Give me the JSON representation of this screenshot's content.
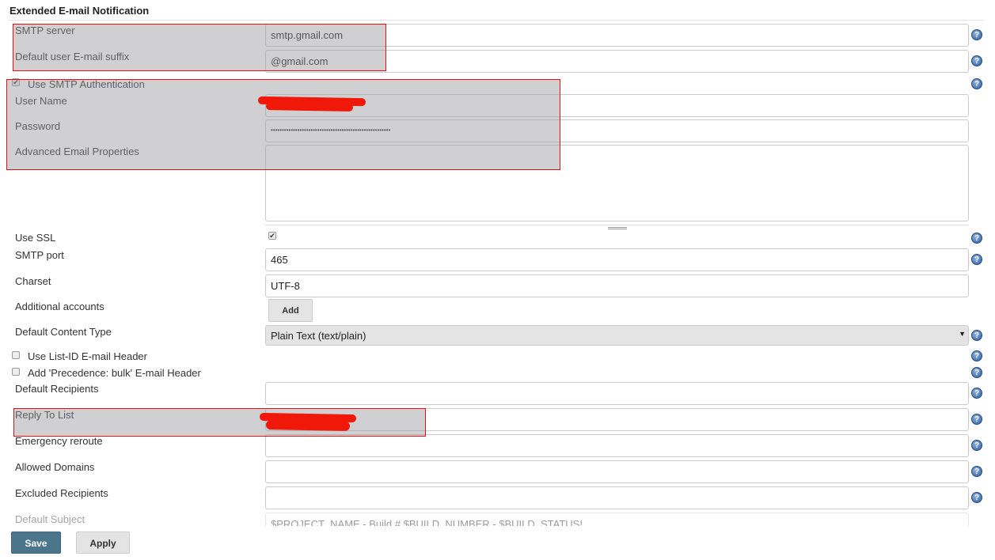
{
  "section_title": "Extended E-mail Notification",
  "fields": {
    "smtp_server": {
      "label": "SMTP server",
      "value": "smtp.gmail.com"
    },
    "email_suffix": {
      "label": "Default user E-mail suffix",
      "value": "@gmail.com"
    },
    "use_smtp_auth": {
      "label": "Use SMTP Authentication",
      "checked": true
    },
    "user_name": {
      "label": "User Name",
      "value": ""
    },
    "password": {
      "label": "Password",
      "value": "••••••••••••••••••••••••••••••••••••••••••••••••••••••"
    },
    "advanced_props": {
      "label": "Advanced Email Properties",
      "value": ""
    },
    "use_ssl": {
      "label": "Use SSL",
      "checked": true
    },
    "smtp_port": {
      "label": "SMTP port",
      "value": "465"
    },
    "charset": {
      "label": "Charset",
      "value": "UTF-8"
    },
    "additional_accounts": {
      "label": "Additional accounts",
      "button": "Add"
    },
    "content_type": {
      "label": "Default Content Type",
      "value": "Plain Text (text/plain)"
    },
    "list_id": {
      "label": "Use List-ID E-mail Header",
      "checked": false
    },
    "precedence": {
      "label": "Add 'Precedence: bulk' E-mail Header",
      "checked": false
    },
    "default_recipients": {
      "label": "Default Recipients",
      "value": ""
    },
    "reply_to": {
      "label": "Reply To List",
      "value": ""
    },
    "emergency_reroute": {
      "label": "Emergency reroute",
      "value": ""
    },
    "allowed_domains": {
      "label": "Allowed Domains",
      "value": ""
    },
    "excluded_recipients": {
      "label": "Excluded Recipients",
      "value": ""
    },
    "default_subject": {
      "label": "Default Subject",
      "value": "$PROJECT_NAME - Build # $BUILD_NUMBER - $BUILD_STATUS!"
    }
  },
  "buttons": {
    "save": "Save",
    "apply": "Apply"
  },
  "help_icon": "question-circle-icon",
  "colors": {
    "save_bg": "#4b758b",
    "annotation_red": "#e01010",
    "redaction": "#f01808"
  }
}
